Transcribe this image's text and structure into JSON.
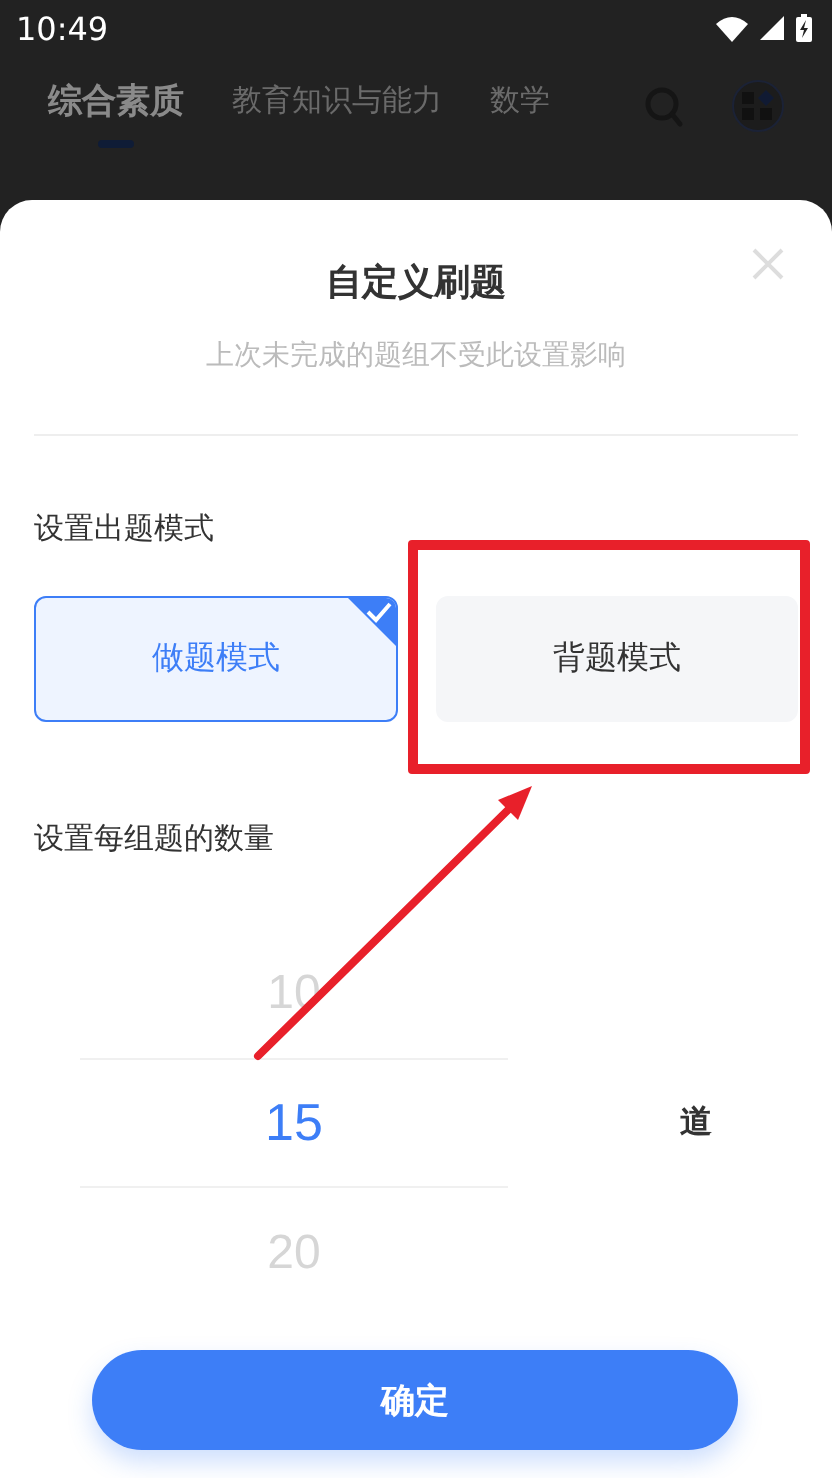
{
  "status_bar": {
    "time": "10:49"
  },
  "tabs": [
    {
      "label": "综合素质",
      "selected": true
    },
    {
      "label": "教育知识与能力",
      "selected": false
    },
    {
      "label": "数学",
      "selected": false
    }
  ],
  "dialog": {
    "title": "自定义刷题",
    "subtitle": "上次未完成的题组不受此设置影响",
    "mode_section": {
      "label": "设置出题模式",
      "options": [
        {
          "label": "做题模式",
          "selected": true
        },
        {
          "label": "背题模式",
          "selected": false
        }
      ]
    },
    "count_section": {
      "label": "设置每组题的数量",
      "picker": [
        {
          "value": "10",
          "selected": false
        },
        {
          "value": "15",
          "selected": true
        },
        {
          "value": "20",
          "selected": false
        }
      ],
      "unit": "道"
    },
    "confirm_button": "确定"
  },
  "annotation": {
    "highlight": true,
    "arrow": true
  }
}
